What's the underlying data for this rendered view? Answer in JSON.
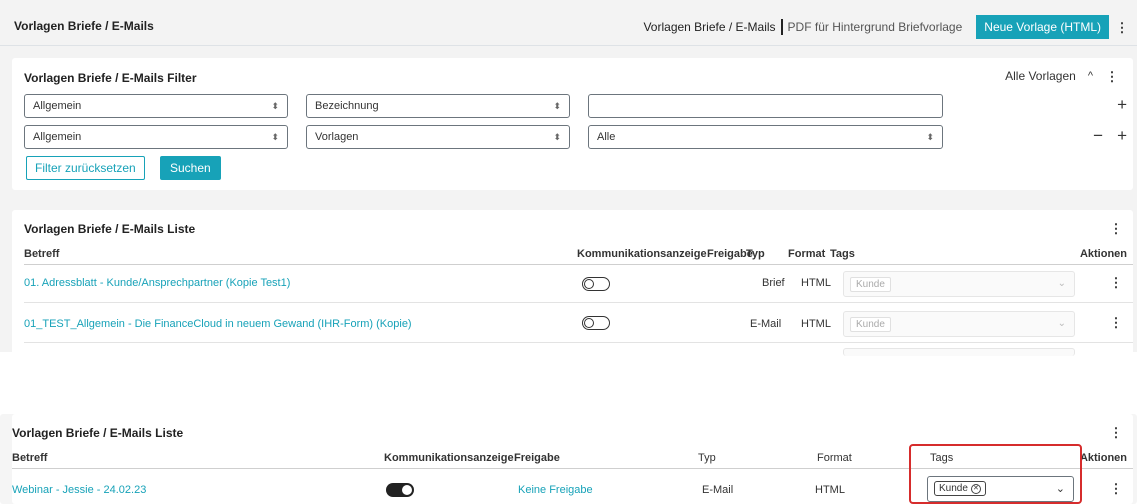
{
  "header": {
    "title": "Vorlagen Briefe / E-Mails",
    "nav_active": "Vorlagen Briefe / E-Mails",
    "nav_pdf": "PDF für Hintergrund Briefvorlage",
    "new_button": "Neue Vorlage (HTML)"
  },
  "filter": {
    "title": "Vorlagen Briefe / E-Mails Filter",
    "all_templates": "Alle Vorlagen",
    "row1": {
      "field1": "Allgemein",
      "field2": "Bezeichnung",
      "value": ""
    },
    "row2": {
      "field1": "Allgemein",
      "field2": "Vorlagen",
      "value": "Alle"
    },
    "reset_button": "Filter zurücksetzen",
    "search_button": "Suchen"
  },
  "list_top": {
    "title": "Vorlagen Briefe / E-Mails Liste",
    "columns": [
      "Betreff",
      "Kommunikationsanzeige",
      "Freigabe",
      "Typ",
      "Format",
      "Tags",
      "Aktionen"
    ],
    "rows": [
      {
        "subject": "01. Adressblatt - Kunde/Ansprechpartner (Kopie Test1)",
        "toggle": "off",
        "type": "Brief",
        "format": "HTML",
        "tag": "Kunde"
      },
      {
        "subject": "01_TEST_Allgemein - Die FinanceCloud in neuem Gewand (IHR-Form) (Kopie)",
        "toggle": "off",
        "type": "E-Mail",
        "format": "HTML",
        "tag": "Kunde"
      }
    ]
  },
  "list_bottom": {
    "title": "Vorlagen Briefe / E-Mails Liste",
    "columns": [
      "Betreff",
      "Kommunikationsanzeige",
      "Freigabe",
      "Typ",
      "Format",
      "Tags",
      "Aktionen"
    ],
    "rows": [
      {
        "subject": "Webinar - Jessie - 24.02.23",
        "toggle": "on",
        "release": "Keine Freigabe",
        "type": "E-Mail",
        "format": "HTML",
        "tag": "Kunde"
      }
    ]
  },
  "icons": {
    "kebab": "⋮",
    "chevron_up": "^",
    "plus": "+",
    "minus": "−",
    "select_caret": "⬍",
    "chevron_down": "⌄"
  },
  "colors": {
    "accent": "#17a2b8",
    "highlight": "#d62c2c"
  }
}
